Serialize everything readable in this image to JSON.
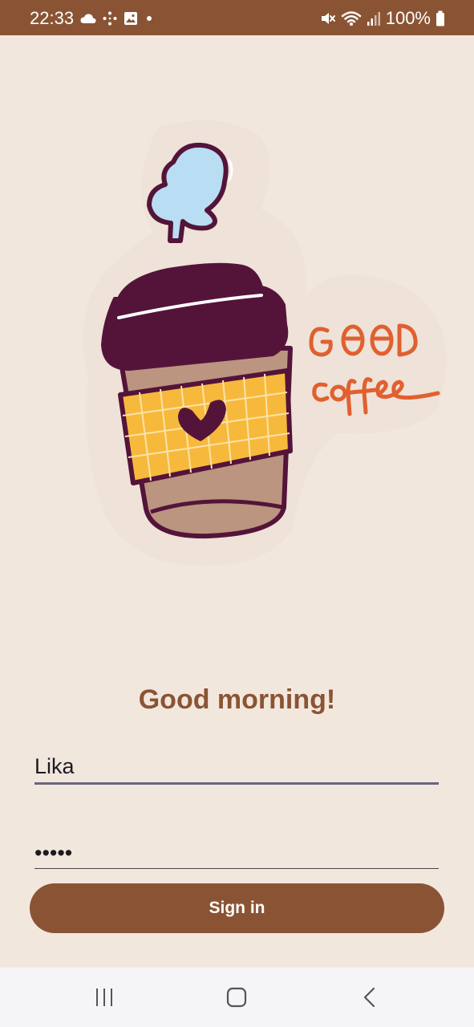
{
  "status_bar": {
    "time": "22:33",
    "battery": "100%",
    "icons_left": [
      "cloud-icon",
      "dots-icon",
      "image-icon",
      "dot-icon"
    ],
    "icons_right": [
      "mute-icon",
      "wifi-icon",
      "signal-icon",
      "battery-icon"
    ],
    "color": "#8A5434"
  },
  "illustration": {
    "icon": "coffee-cup-illustration",
    "lettering": "GOOD coffee"
  },
  "greeting": "Good morning!",
  "form": {
    "username": "Lika",
    "password": "•••••",
    "sign_in_label": "Sign in"
  },
  "nav_bar": {
    "icons": [
      "recent-apps-icon",
      "home-icon",
      "back-icon"
    ]
  },
  "colors": {
    "background": "#F2E7DD",
    "accent": "#8A5434",
    "text": "#1C1B1F"
  }
}
